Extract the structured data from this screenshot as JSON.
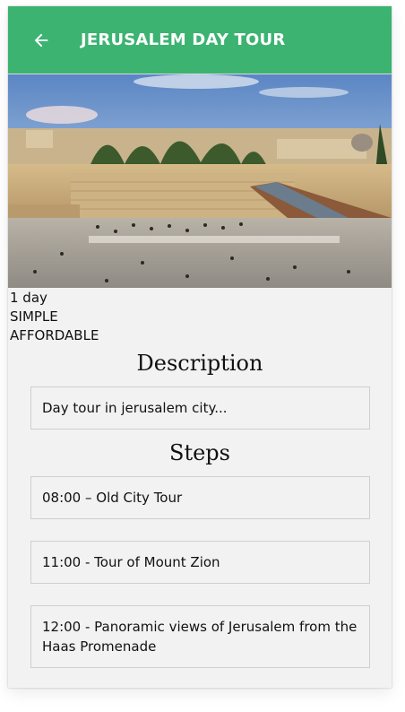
{
  "header": {
    "back_icon": "arrow-left-icon",
    "title": "JERUSALEM DAY TOUR",
    "background": "#3cb371"
  },
  "tour": {
    "duration": "1 day",
    "difficulty": "SIMPLE",
    "price_level": "AFFORDABLE"
  },
  "description": {
    "heading": "Description",
    "text": "Day tour in jerusalem city..."
  },
  "steps": {
    "heading": "Steps",
    "items": [
      "08:00 – Old City Tour",
      "11:00 - Tour of Mount Zion",
      "12:00 - Panoramic views of Jerusalem from the Haas Promenade"
    ]
  }
}
